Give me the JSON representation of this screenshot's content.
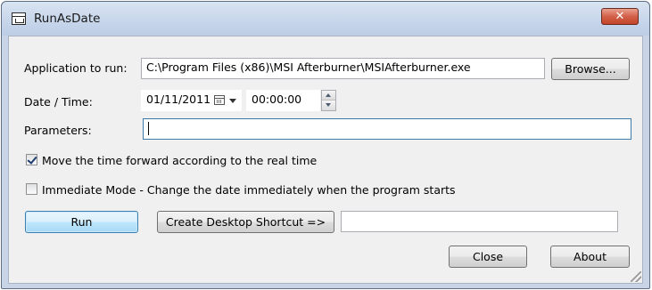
{
  "window": {
    "title": "RunAsDate",
    "close_glyph": "✕",
    "icon": "calendar-window-icon"
  },
  "form": {
    "app_label": "Application to run:",
    "app_value": "C:\\Program Files (x86)\\MSI Afterburner\\MSIAfterburner.exe",
    "browse_label": "Browse...",
    "datetime_label": "Date / Time:",
    "date_value": "01/11/2011",
    "time_value": "00:00:00",
    "params_label": "Parameters:",
    "params_value": "",
    "move_time_label": "Move the time forward according to the real time",
    "move_time_checked": true,
    "immediate_label": "Immediate Mode - Change the date immediately when the program starts",
    "immediate_checked": false
  },
  "actions": {
    "run_label": "Run",
    "shortcut_label": "Create Desktop Shortcut =>",
    "shortcut_name_value": "",
    "close_label": "Close",
    "about_label": "About"
  }
}
